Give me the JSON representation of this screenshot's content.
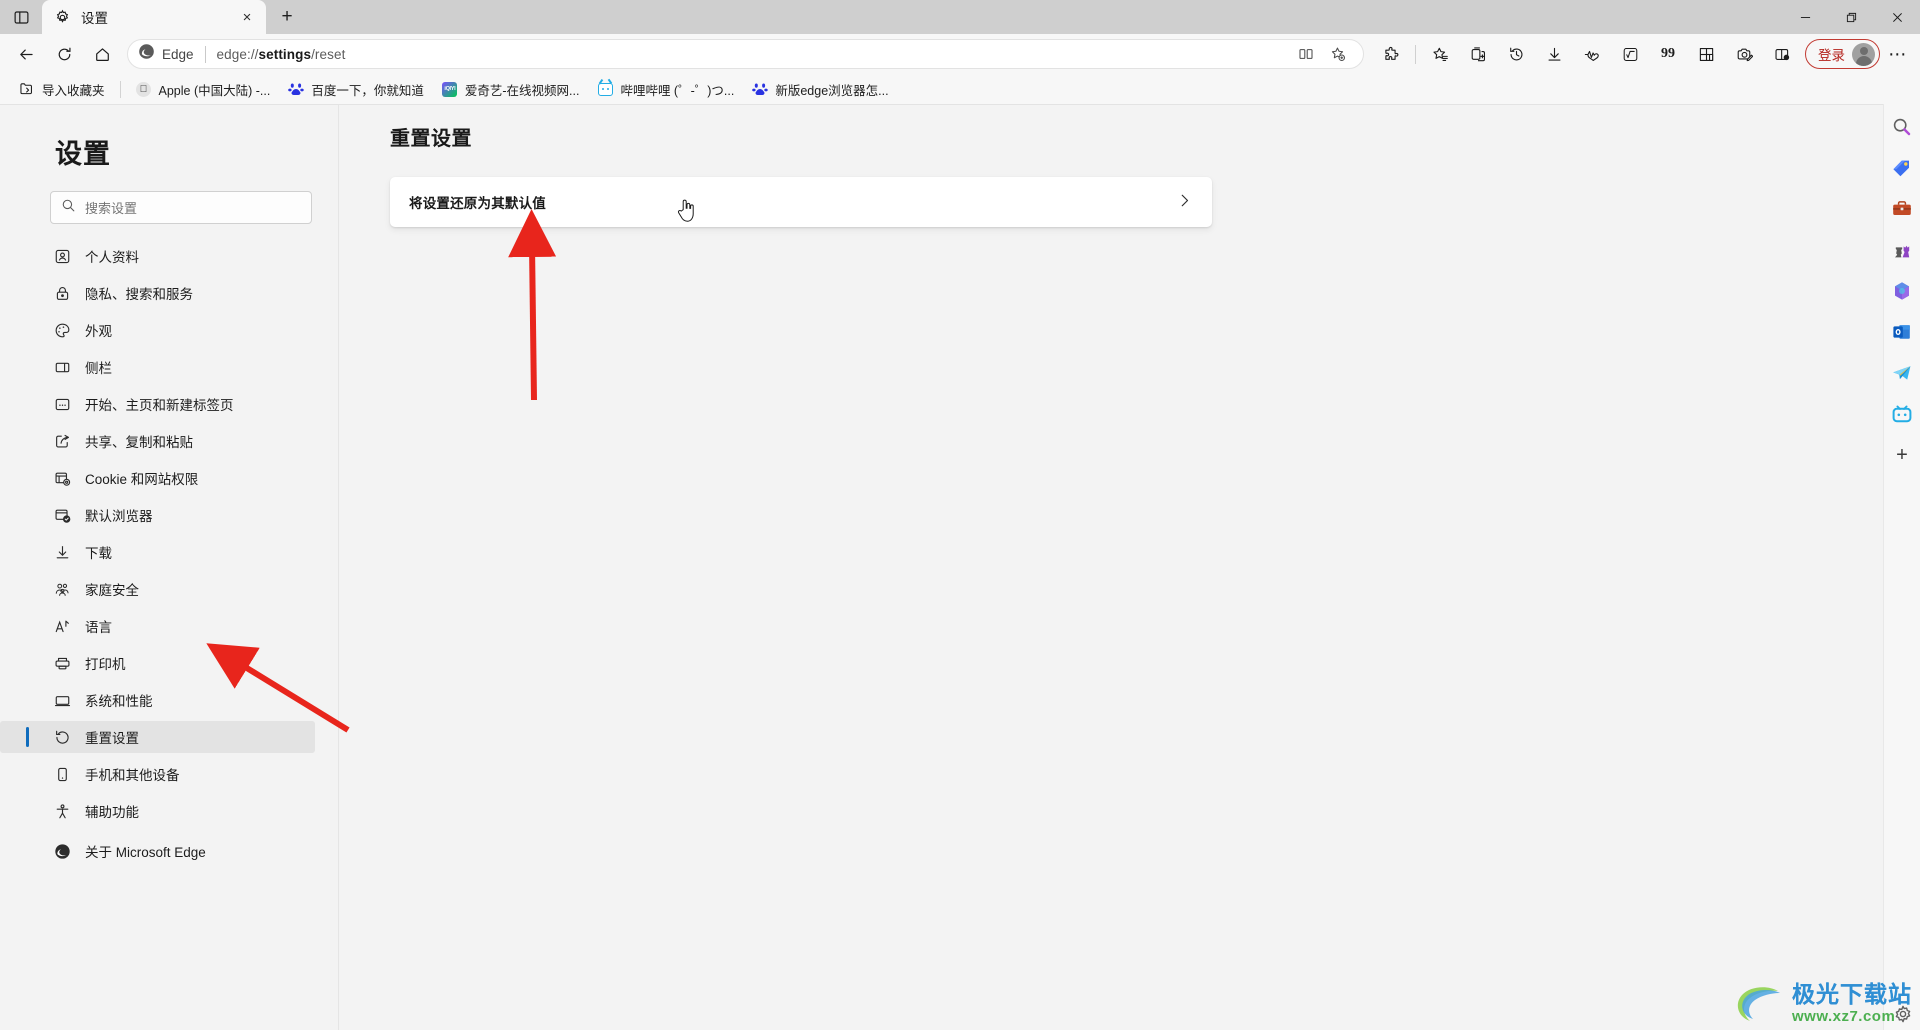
{
  "window": {
    "controls": {
      "minimize": "minimize-button",
      "restore": "restore-button",
      "close": "close-button"
    }
  },
  "tabstrip": {
    "tab_search_label": "tab-search",
    "tabs": [
      {
        "title": "设置",
        "favicon": "gear-icon",
        "close_label": "×"
      }
    ],
    "new_tab_label": "+"
  },
  "toolbar": {
    "back_label": "back-icon",
    "refresh_label": "refresh-icon",
    "home_label": "home-icon",
    "address": {
      "identity_label": "Edge",
      "url_prefix": "edge://",
      "url_bold": "settings",
      "url_suffix": "/reset",
      "full_url": "edge://settings/reset",
      "split_screen_label": "split-screen-icon",
      "favorite_label": "add-favorite-icon"
    },
    "right_icons": [
      "extensions-icon",
      "favorites-icon",
      "collections-icon",
      "history-icon",
      "downloads-icon",
      "performance-icon",
      "math-solver-icon",
      "quote-icon",
      "browser-essentials-icon",
      "screenshot-icon",
      "split-window-icon"
    ],
    "signin": {
      "label": "登录",
      "avatar": "user-avatar"
    },
    "more_label": "⋯"
  },
  "bookmarks": {
    "import_label": "导入收藏夹",
    "items": [
      {
        "label": "Apple (中国大陆) -...",
        "icon": "apple-icon"
      },
      {
        "label": "百度一下，你就知道",
        "icon": "baidu-icon"
      },
      {
        "label": "爱奇艺-在线视频网...",
        "icon": "iqiyi-icon"
      },
      {
        "label": "哔哩哔哩 (゜-゜)つ...",
        "icon": "bilibili-icon"
      },
      {
        "label": "新版edge浏览器怎...",
        "icon": "baidu-icon"
      }
    ]
  },
  "sidebar": {
    "title": "设置",
    "search": {
      "placeholder": "搜索设置",
      "value": "",
      "icon": "search-icon"
    },
    "items": [
      {
        "label": "个人资料",
        "icon": "profile-icon",
        "active": false
      },
      {
        "label": "隐私、搜索和服务",
        "icon": "lock-icon",
        "active": false
      },
      {
        "label": "外观",
        "icon": "palette-icon",
        "active": false
      },
      {
        "label": "侧栏",
        "icon": "sidebar-icon",
        "active": false
      },
      {
        "label": "开始、主页和新建标签页",
        "icon": "startpage-icon",
        "active": false
      },
      {
        "label": "共享、复制和粘贴",
        "icon": "share-icon",
        "active": false
      },
      {
        "label": "Cookie 和网站权限",
        "icon": "cookie-icon",
        "active": false
      },
      {
        "label": "默认浏览器",
        "icon": "default-browser-icon",
        "active": false
      },
      {
        "label": "下载",
        "icon": "download-icon",
        "active": false
      },
      {
        "label": "家庭安全",
        "icon": "family-icon",
        "active": false
      },
      {
        "label": "语言",
        "icon": "language-icon",
        "active": false
      },
      {
        "label": "打印机",
        "icon": "printer-icon",
        "active": false
      },
      {
        "label": "系统和性能",
        "icon": "system-icon",
        "active": false
      },
      {
        "label": "重置设置",
        "icon": "reset-icon",
        "active": true
      },
      {
        "label": "手机和其他设备",
        "icon": "phone-icon",
        "active": false
      },
      {
        "label": "辅助功能",
        "icon": "accessibility-icon",
        "active": false
      },
      {
        "label": "关于 Microsoft Edge",
        "icon": "edge-logo-icon",
        "active": false
      }
    ]
  },
  "main": {
    "heading": "重置设置",
    "cards": [
      {
        "label": "将设置还原为其默认值",
        "chevron": "chevron-right-icon"
      }
    ]
  },
  "rail": {
    "icons": [
      "search-icon",
      "shopping-tag-icon",
      "briefcase-icon",
      "games-icon",
      "microsoft365-icon",
      "outlook-icon",
      "telegram-icon",
      "bilibili-icon"
    ],
    "add_label": "+"
  },
  "annotations": {
    "arrows": [
      "arrow-to-restore-card",
      "arrow-to-reset-settings-nav"
    ],
    "cursor": "hand-cursor"
  },
  "watermark": {
    "title": "极光下载站",
    "url": "www.xz7.com"
  },
  "colors": {
    "accent": "#0f6cbd",
    "annotation_red": "#e8251c",
    "signin_red": "#b4231c",
    "page_bg": "#f3f3f3",
    "chrome_bg": "#f7f7f7",
    "titlebar_bg": "#cfcfcf"
  }
}
